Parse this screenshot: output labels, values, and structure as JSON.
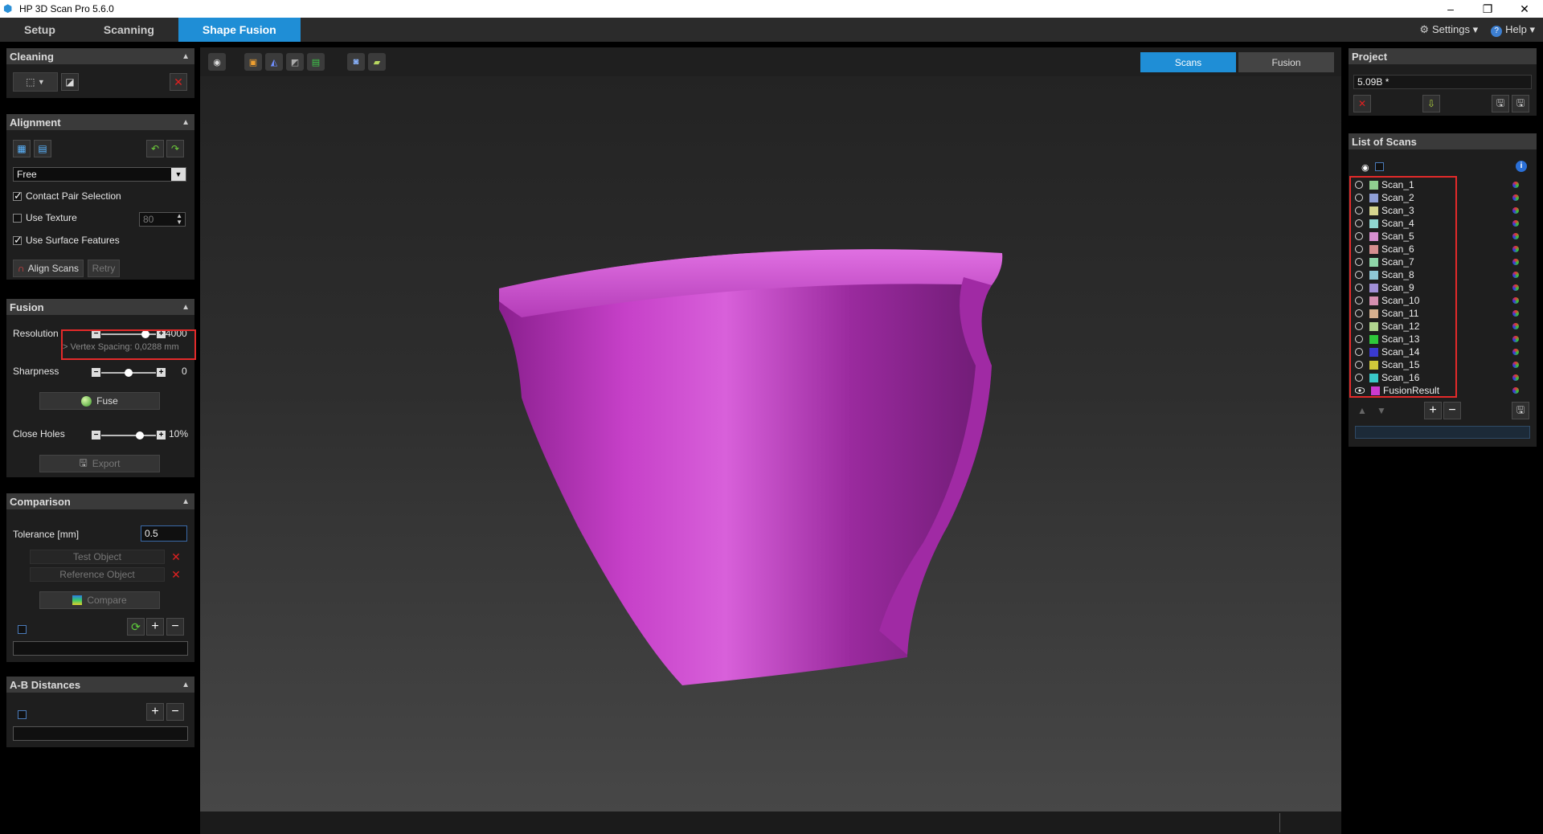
{
  "window": {
    "title": "HP 3D Scan Pro 5.6.0",
    "minimize": "–",
    "maximize": "❐",
    "close": "✕"
  },
  "tabs": [
    {
      "label": "Setup"
    },
    {
      "label": "Scanning"
    },
    {
      "label": "Shape Fusion"
    }
  ],
  "topright": {
    "settings": "Settings ▾",
    "help": "Help ▾"
  },
  "cleaning": {
    "title": "Cleaning"
  },
  "alignment": {
    "title": "Alignment",
    "mode": "Free",
    "contact_pair": "Contact Pair Selection",
    "use_texture": "Use Texture",
    "texture_value": "80",
    "use_surface": "Use Surface Features",
    "align_button": "Align Scans",
    "retry_button": "Retry"
  },
  "fusion": {
    "title": "Fusion",
    "resolution_label": "Resolution",
    "resolution_value": "4000",
    "vertex_spacing": "> Vertex Spacing: 0,0288 mm",
    "resolution_level": 0.86,
    "sharpness_label": "Sharpness",
    "sharpness_value": "0",
    "sharpness_level": 0.5,
    "fuse_button": "Fuse",
    "close_holes_label": "Close Holes",
    "close_holes_value": "10%",
    "close_holes_level": 0.74,
    "export_button": "Export"
  },
  "comparison": {
    "title": "Comparison",
    "tolerance_label": "Tolerance [mm]",
    "tolerance_value": "0.5",
    "test_object": "Test Object",
    "reference_object": "Reference Object",
    "compare_button": "Compare"
  },
  "ab_distances": {
    "title": "A-B Distances"
  },
  "viewport": {
    "scans_tab": "Scans",
    "fusion_tab": "Fusion"
  },
  "project": {
    "title": "Project",
    "name": "5.09B *"
  },
  "scan_list": {
    "title": "List of Scans",
    "items": [
      {
        "label": "Scan_1",
        "color": "#8fce8f"
      },
      {
        "label": "Scan_2",
        "color": "#8f9fd6"
      },
      {
        "label": "Scan_3",
        "color": "#d6d68f"
      },
      {
        "label": "Scan_4",
        "color": "#8fd6d0"
      },
      {
        "label": "Scan_5",
        "color": "#d68fd0"
      },
      {
        "label": "Scan_6",
        "color": "#d68f8f"
      },
      {
        "label": "Scan_7",
        "color": "#8fd6a8"
      },
      {
        "label": "Scan_8",
        "color": "#8fc8d6"
      },
      {
        "label": "Scan_9",
        "color": "#a08fd6"
      },
      {
        "label": "Scan_10",
        "color": "#d68fb0"
      },
      {
        "label": "Scan_11",
        "color": "#d6b08f"
      },
      {
        "label": "Scan_12",
        "color": "#b0d68f"
      },
      {
        "label": "Scan_13",
        "color": "#2ec83a"
      },
      {
        "label": "Scan_14",
        "color": "#3a3ad0"
      },
      {
        "label": "Scan_15",
        "color": "#d0c83a"
      },
      {
        "label": "Scan_16",
        "color": "#3ac8c8"
      },
      {
        "label": "FusionResult",
        "color": "#cc3ad0"
      }
    ]
  },
  "object_color": "#c640c8"
}
